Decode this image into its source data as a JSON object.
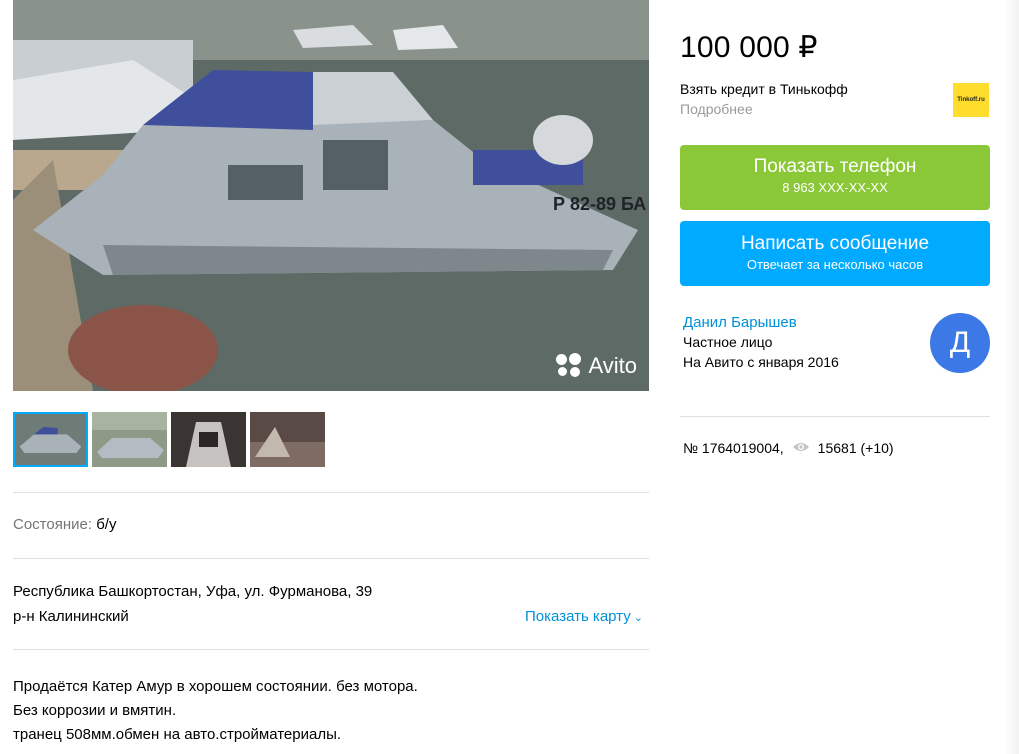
{
  "gallery": {
    "watermark_text": "Avito",
    "thumbnails": [
      {
        "icon": "boat-photo-1",
        "active": true
      },
      {
        "icon": "boat-photo-2",
        "active": false
      },
      {
        "icon": "boat-photo-interior",
        "active": false
      },
      {
        "icon": "boat-photo-engine",
        "active": false
      }
    ]
  },
  "details": {
    "condition_label": "Состояние:",
    "condition_value": "б/у",
    "address_line1": "Республика Башкортостан, Уфа, ул. Фурманова, 39",
    "address_line2": "р-н Калининский",
    "show_map": "Показать карту",
    "description": [
      "Продаётся Катер Амур в хорошем состоянии. без мотора.",
      "Без коррозии и вмятин.",
      "транец 508мм.обмен на авто.стройматериалы."
    ]
  },
  "sidebar": {
    "price": "100 000 ₽",
    "credit_text": "Взять кредит в Тинькофф",
    "credit_more": "Подробнее",
    "bank_logo_text": "Tinkoff.ru",
    "phone_button": {
      "label": "Показать телефон",
      "number": "8 963 XXX-XX-XX"
    },
    "message_button": {
      "label": "Написать сообщение",
      "sub": "Отвечает за несколько часов"
    },
    "seller": {
      "name": "Данил Барышев",
      "type": "Частное лицо",
      "since": "На Авито с января 2016",
      "avatar_letter": "Д"
    },
    "listing_id": "№ 1764019004,",
    "views": "15681 (+10)"
  },
  "colors": {
    "green_button": "#8bc838",
    "blue_button": "#00aaff",
    "link": "#0091d9",
    "avatar": "#3c79e6",
    "tinkoff_yellow": "#ffdd2d"
  }
}
